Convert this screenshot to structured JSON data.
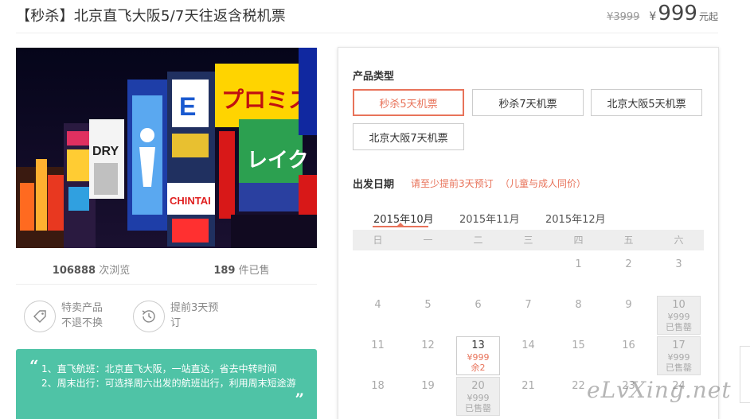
{
  "header": {
    "title": "【秒杀】北京直飞大阪5/7天往返含税机票",
    "old_price": "¥3999",
    "currency": "¥",
    "price": "999",
    "price_unit": "元起"
  },
  "stats": {
    "views_count": "106888",
    "views_label": "次浏览",
    "sold_count": "189",
    "sold_label": "件已售"
  },
  "features": [
    {
      "icon": "tag-icon",
      "text": "特卖产品 不退不换"
    },
    {
      "icon": "clock-history-icon",
      "text": "提前3天预订"
    }
  ],
  "note": {
    "line1": "1、直飞航班：北京直飞大阪，一站直达，省去中转时间",
    "line2": "2、周末出行：可选择周六出发的航班出行，利用周末短途游"
  },
  "product_type": {
    "label": "产品类型",
    "options": [
      "秒杀5天机票",
      "秒杀7天机票",
      "北京大阪5天机票",
      "北京大阪7天机票"
    ],
    "selected": "秒杀5天机票"
  },
  "departure": {
    "label": "出发日期",
    "hint1": "请至少提前3天预订",
    "hint2": "（儿童与成人同价）"
  },
  "months": [
    "2015年10月",
    "2015年11月",
    "2015年12月"
  ],
  "selected_month": "2015年10月",
  "weekdays": [
    "日",
    "一",
    "二",
    "三",
    "四",
    "五",
    "六"
  ],
  "calendar": {
    "rows": [
      [
        null,
        null,
        null,
        null,
        {
          "day": "1"
        },
        {
          "day": "2"
        },
        {
          "day": "3"
        }
      ],
      [
        {
          "day": "4"
        },
        {
          "day": "5"
        },
        {
          "day": "6"
        },
        {
          "day": "7"
        },
        {
          "day": "8"
        },
        {
          "day": "9"
        },
        {
          "day": "10",
          "price": "¥999",
          "status": "已售罄",
          "state": "sold"
        }
      ],
      [
        {
          "day": "11"
        },
        {
          "day": "12"
        },
        {
          "day": "13",
          "price": "¥999",
          "status": "余2",
          "state": "avail"
        },
        {
          "day": "14"
        },
        {
          "day": "15"
        },
        {
          "day": "16"
        },
        {
          "day": "17",
          "price": "¥999",
          "status": "已售罄",
          "state": "sold"
        }
      ],
      [
        {
          "day": "18"
        },
        {
          "day": "19"
        },
        {
          "day": "20",
          "price": "¥999",
          "status": "已售罄",
          "state": "sold"
        },
        {
          "day": "21"
        },
        {
          "day": "22"
        },
        {
          "day": "23"
        },
        {
          "day": "24"
        }
      ]
    ]
  },
  "watermark": "eLvXing.net",
  "colors": {
    "accent": "#e8735a",
    "note_bg": "#4fc3a6"
  }
}
